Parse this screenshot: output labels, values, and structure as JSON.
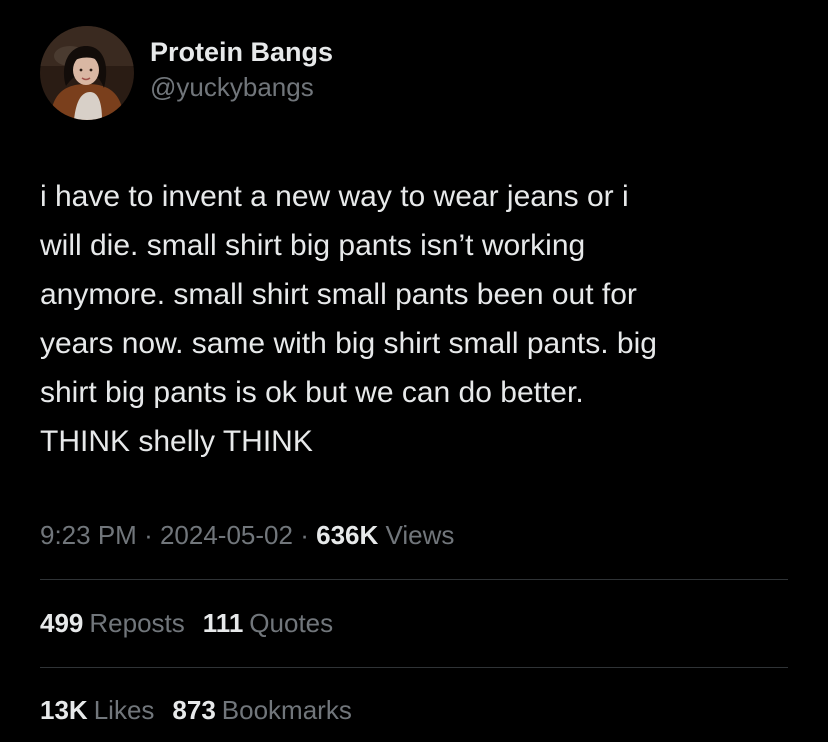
{
  "user": {
    "display_name": "Protein Bangs",
    "handle": "@yuckybangs"
  },
  "tweet": {
    "text": "i have to invent a new way to wear jeans or i\nwill die. small shirt big pants isn’t working\nanymore. small shirt small pants been out for\nyears now. same with big shirt small pants. big\nshirt big pants is ok but we can do better.\nTHINK shelly THINK",
    "time": "9:23 PM",
    "separator": "·",
    "date": "2024-05-02",
    "views_count": "636K",
    "views_label": "Views"
  },
  "stats": {
    "reposts_count": "499",
    "reposts_label": "Reposts",
    "quotes_count": "111",
    "quotes_label": "Quotes",
    "likes_count": "13K",
    "likes_label": "Likes",
    "bookmarks_count": "873",
    "bookmarks_label": "Bookmarks"
  },
  "colors": {
    "background": "#000000",
    "primary_text": "#e7e9ea",
    "secondary_text": "#71767b",
    "divider": "#2f3336"
  }
}
